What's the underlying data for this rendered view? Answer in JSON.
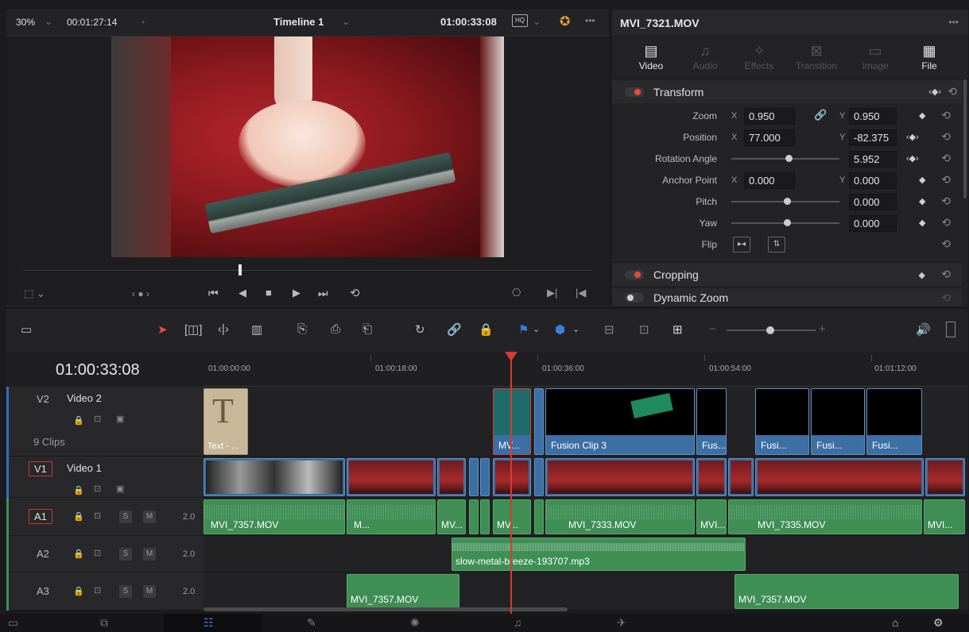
{
  "viewer": {
    "zoom": "30%",
    "source_timecode": "00:01:27:14",
    "timeline_name": "Timeline 1",
    "record_timecode": "01:00:33:08"
  },
  "inspector": {
    "clip_name": "MVI_7321.MOV",
    "tabs": [
      {
        "label": "Video",
        "active": true
      },
      {
        "label": "Audio"
      },
      {
        "label": "Effects"
      },
      {
        "label": "Transition"
      },
      {
        "label": "Image"
      },
      {
        "label": "File"
      }
    ],
    "transform": {
      "title": "Transform",
      "zoom_label": "Zoom",
      "zoom_x": "0.950",
      "zoom_y": "0.950",
      "position_label": "Position",
      "position_x": "77.000",
      "position_y": "-82.375",
      "rotation_label": "Rotation Angle",
      "rotation": "5.952",
      "anchor_label": "Anchor Point",
      "anchor_x": "0.000",
      "anchor_y": "0.000",
      "pitch_label": "Pitch",
      "pitch": "0.000",
      "yaw_label": "Yaw",
      "yaw": "0.000",
      "flip_label": "Flip",
      "x_axis": "X",
      "y_axis": "Y"
    },
    "cropping": "Cropping",
    "dynamic_zoom": "Dynamic Zoom"
  },
  "timeline": {
    "timecode": "01:00:33:08",
    "ruler": [
      "01:00:00:00",
      "01:00:18:00",
      "01:00:36:00",
      "01:00:54:00",
      "01:01:12:00"
    ],
    "tracks": {
      "v2": {
        "id": "V2",
        "name": "Video 2",
        "clips_count": "9 Clips"
      },
      "v1": {
        "id": "V1",
        "name": "Video 1"
      },
      "a1": {
        "id": "A1",
        "level": "2.0"
      },
      "a2": {
        "id": "A2",
        "level": "2.0"
      },
      "a3": {
        "id": "A3",
        "level": "2.0"
      }
    },
    "v2_clips": [
      "Text - ...",
      "MV...",
      "Fusion Clip 3",
      "Fus...",
      "Fusi...",
      "Fusi...",
      "Fusi..."
    ],
    "a1_clips": [
      "MVI_7357.MOV",
      "M...",
      "MV...",
      "MV...",
      "MVI_7333.MOV",
      "MVI...",
      "MVI_7335.MOV",
      "MVI..."
    ],
    "a2_clip": "slow-metal-breeze-193707.mp3",
    "a3_clips": [
      "MVI_7357.MOV",
      "MVI_7357.MOV"
    ],
    "solo": "S",
    "mute": "M"
  }
}
